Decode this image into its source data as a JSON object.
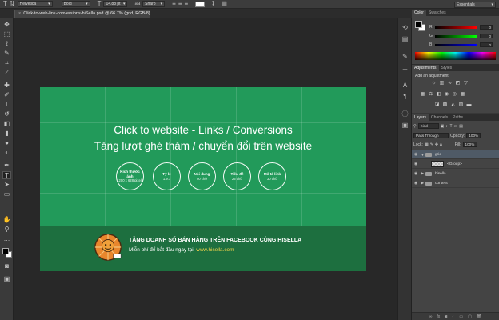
{
  "options_bar": {
    "font_family": "Helvetica",
    "font_style": "Bold",
    "font_size": "14.88 pt",
    "aa_method": "Sharp",
    "text_color": "#ffffff",
    "workspace": "Essentials"
  },
  "document": {
    "tab_title": "Click-to-web-link-conversions-hiSella.psd @ 66.7% (grid, RGB/8)"
  },
  "canvas": {
    "background_color": "#229a5a",
    "headline": "Click to website - Links / Conversions",
    "subline": "Tăng lượt ghé thăm / chuyển đổi trên website",
    "circles": [
      {
        "title": "Kích thước ảnh",
        "value": "1200 x 628 pixels"
      },
      {
        "title": "Tỷ lệ",
        "value": "1.9:1"
      },
      {
        "title": "Nội dung",
        "value": "90 chữ"
      },
      {
        "title": "Tiêu đề",
        "value": "25 chữ"
      },
      {
        "title": "Mô tả link",
        "value": "30 chữ"
      }
    ],
    "promo_title": "TĂNG DOANH SỐ BÁN HÀNG TRÊN FACEBOOK CÙNG HISELLA",
    "promo_sub_prefix": "Miễn phí để bắt đầu ngay tại: ",
    "promo_link": "www.hisella.com"
  },
  "color_panel": {
    "tabs": [
      "Color",
      "Swatches"
    ],
    "sliders": [
      {
        "label": "R",
        "value": "0",
        "color": "#d33"
      },
      {
        "label": "G",
        "value": "0",
        "color": "#3c3"
      },
      {
        "label": "B",
        "value": "0",
        "color": "#36d"
      }
    ]
  },
  "adjustments_panel": {
    "tabs": [
      "Adjustments",
      "Styles"
    ],
    "heading": "Add an adjustment"
  },
  "layers_panel": {
    "tabs": [
      "Layers",
      "Channels",
      "Paths"
    ],
    "kind": "Kind",
    "blend_mode": "Pass Through",
    "opacity_label": "Opacity:",
    "opacity": "100%",
    "lock_label": "Lock:",
    "fill_label": "Fill:",
    "fill": "100%",
    "layers": [
      {
        "name": "grid",
        "type": "group",
        "expanded": true,
        "selected": true
      },
      {
        "name": "<Group>",
        "type": "smart",
        "expanded": false,
        "selected": false
      },
      {
        "name": "hisella",
        "type": "group",
        "expanded": false,
        "selected": false
      },
      {
        "name": "content",
        "type": "group",
        "expanded": false,
        "selected": false
      }
    ]
  }
}
